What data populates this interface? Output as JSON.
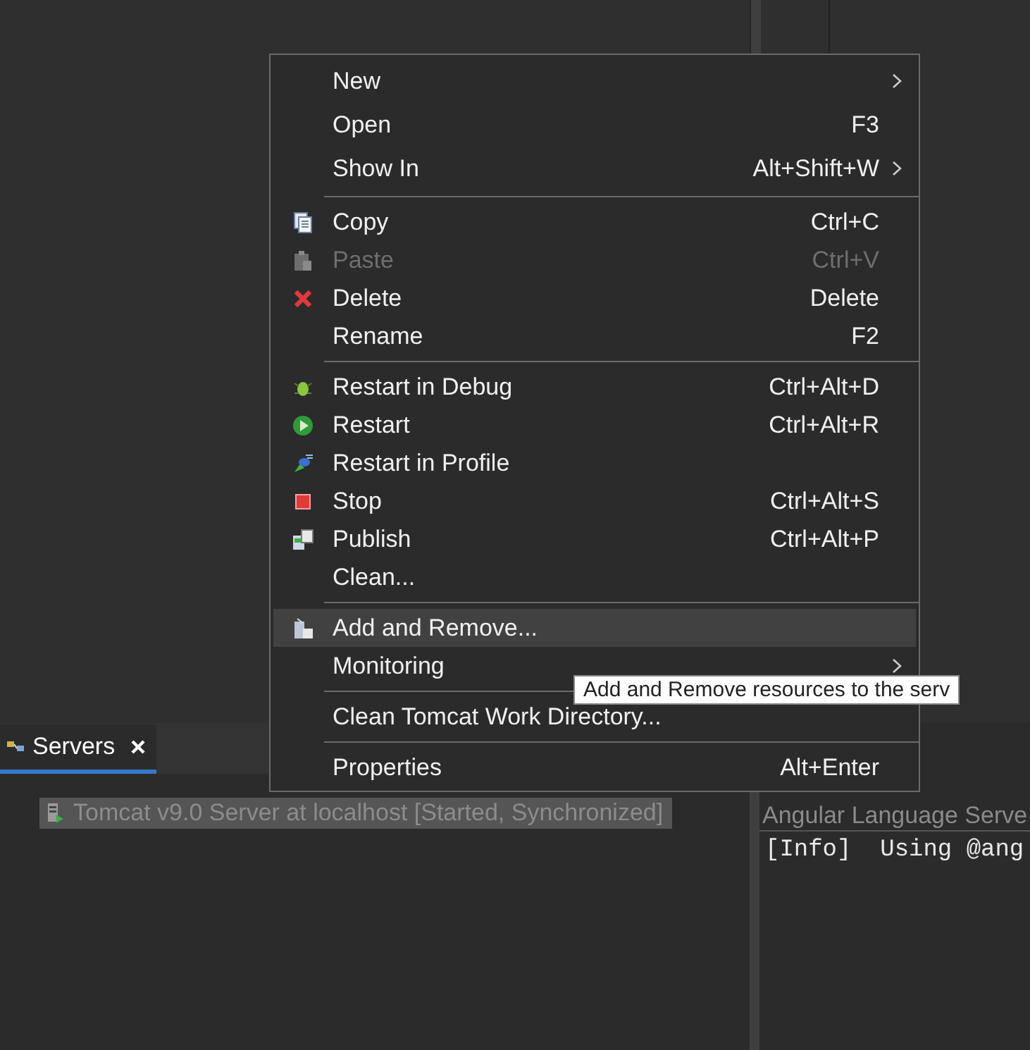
{
  "servers_view": {
    "tab": {
      "label": "Servers",
      "selected": true
    },
    "rows": [
      {
        "label": "Tomcat v9.0 Server at localhost  [Started, Synchronized]",
        "selected": true
      }
    ]
  },
  "console_view": {
    "header": "Angular Language Serve",
    "lines": [
      "[Info]  Using @ang"
    ]
  },
  "context_menu": {
    "items": [
      {
        "kind": "item",
        "label": "New",
        "submenu": true,
        "disabled": false,
        "selected": false
      },
      {
        "kind": "item",
        "label": "Open",
        "shortcut": "F3",
        "submenu": false,
        "disabled": false,
        "selected": false
      },
      {
        "kind": "item",
        "label": "Show In",
        "shortcut": "Alt+Shift+W",
        "submenu": true,
        "disabled": false,
        "selected": false
      },
      {
        "kind": "separator"
      },
      {
        "kind": "item",
        "label": "Copy",
        "shortcut": "Ctrl+C",
        "submenu": false,
        "disabled": false,
        "selected": false
      },
      {
        "kind": "item",
        "label": "Paste",
        "shortcut": "Ctrl+V",
        "submenu": false,
        "disabled": true,
        "selected": false
      },
      {
        "kind": "item",
        "label": "Delete",
        "shortcut": "Delete",
        "submenu": false,
        "disabled": false,
        "selected": false
      },
      {
        "kind": "item",
        "label": "Rename",
        "shortcut": "F2",
        "submenu": false,
        "disabled": false,
        "selected": false
      },
      {
        "kind": "separator"
      },
      {
        "kind": "item",
        "label": "Restart in Debug",
        "shortcut": "Ctrl+Alt+D",
        "submenu": false,
        "disabled": false,
        "selected": false
      },
      {
        "kind": "item",
        "label": "Restart",
        "shortcut": "Ctrl+Alt+R",
        "submenu": false,
        "disabled": false,
        "selected": false
      },
      {
        "kind": "item",
        "label": "Restart in Profile",
        "submenu": false,
        "disabled": false,
        "selected": false
      },
      {
        "kind": "item",
        "label": "Stop",
        "shortcut": "Ctrl+Alt+S",
        "submenu": false,
        "disabled": false,
        "selected": false
      },
      {
        "kind": "item",
        "label": "Publish",
        "shortcut": "Ctrl+Alt+P",
        "submenu": false,
        "disabled": false,
        "selected": false
      },
      {
        "kind": "item",
        "label": "Clean...",
        "submenu": false,
        "disabled": false,
        "selected": false
      },
      {
        "kind": "separator"
      },
      {
        "kind": "item",
        "label": "Add and Remove...",
        "submenu": false,
        "disabled": false,
        "selected": true
      },
      {
        "kind": "item",
        "label": "Monitoring",
        "submenu": true,
        "disabled": false,
        "selected": false
      },
      {
        "kind": "separator"
      },
      {
        "kind": "item",
        "label": "Clean Tomcat Work Directory...",
        "submenu": false,
        "disabled": false,
        "selected": false
      },
      {
        "kind": "separator"
      },
      {
        "kind": "item",
        "label": "Properties",
        "shortcut": "Alt+Enter",
        "submenu": false,
        "disabled": false,
        "selected": false
      }
    ]
  },
  "tooltip": {
    "text": "Add and Remove resources to the serv"
  }
}
